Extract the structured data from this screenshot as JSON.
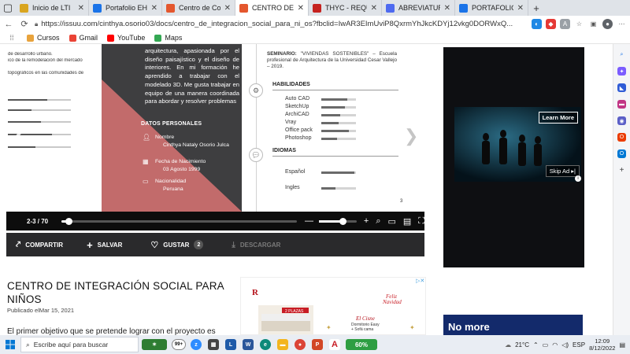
{
  "browser": {
    "tabs": [
      {
        "label": "Inicio de LTI",
        "fav": "#d9a520",
        "active": false
      },
      {
        "label": "Portafolio EHYSC",
        "fav": "#1a73e8",
        "active": false
      },
      {
        "label": "Centro de Conve",
        "fav": "#e4572e",
        "active": false
      },
      {
        "label": "CENTRO DE INTE",
        "fav": "#e4572e",
        "active": true
      },
      {
        "label": "THYC - REQUISIT",
        "fav": "#c5221f",
        "active": false
      },
      {
        "label": "ABREVIATURAS D",
        "fav": "#4e6af0",
        "active": false
      },
      {
        "label": "PORTAFOLIO - A",
        "fav": "#1a73e8",
        "active": false
      }
    ],
    "url": "https://issuu.com/cinthya.osorio03/docs/centro_de_integracion_social_para_ni_os?fbclid=IwAR3EImUviP8QxrmYhJkcKDYj12vkg0DORWxQ...",
    "bookmarks": [
      {
        "label": "Cursos",
        "color": "#e8a33d"
      },
      {
        "label": "Gmail",
        "color": "#ea4335"
      },
      {
        "label": "YouTube",
        "color": "#ff0000"
      },
      {
        "label": "Maps",
        "color": "#34a853"
      }
    ]
  },
  "doc": {
    "left_lines": [
      "de desarrollo urbano.",
      "ico de la remodelación del mercado",
      "",
      "topográficos en las comunidades de"
    ],
    "left_bars": [
      0.62,
      0.38,
      0.52,
      0.7,
      0.44
    ],
    "profile_text": "arquitectura, apasionada por el diseño paisajístico y el diseño de interiores. En mi formación he aprendido a trabajar con el modelado 3D. Me gusta trabajar en equipo de una manera coordinada para abordar y resolver problemas",
    "personal_heading": "DATOS PERSONALES",
    "personal": [
      {
        "label": "Nombre",
        "value": "Cinthya Nataly Osorio Julca"
      },
      {
        "label": "Fecha de Nacimiento",
        "value": "03 Agosto 1999"
      },
      {
        "label": "Nacionalidad",
        "value": "Peruana"
      }
    ],
    "seminar_label": "SEMINARIO:",
    "seminar_text": " \"VIVIENDAS SOSTENIBLES\" – Escuela profesional de Arquitectura de la Universidad Cesar Vallejo – 2019.",
    "skills_heading": "HABILIDADES",
    "skills": [
      {
        "name": "Auto CAD",
        "level": 0.75
      },
      {
        "name": "SketchUp",
        "level": 0.68
      },
      {
        "name": "ArchiCAD",
        "level": 0.55
      },
      {
        "name": "Vray",
        "level": 0.5
      },
      {
        "name": "Office pack",
        "level": 0.8
      },
      {
        "name": "Photoshop",
        "level": 0.45
      }
    ],
    "languages_heading": "IDIOMAS",
    "languages": [
      {
        "name": "Español",
        "level": 0.95
      },
      {
        "name": "Ingles",
        "level": 0.4
      }
    ],
    "page_number": "3"
  },
  "viewer": {
    "pager": "2-3 / 70",
    "progress": 0.03,
    "zoom": 0.62
  },
  "actions": {
    "share": "COMPARTIR",
    "save": "SALVAR",
    "like": "GUSTAR",
    "like_count": "2",
    "download": "DESCARGAR"
  },
  "article": {
    "title": "CENTRO DE INTEGRACIÓN SOCIAL PARA NIÑOS",
    "meta": "Publicado elMar 15, 2021",
    "body": "El primer objetivo que se pretende lograr con el proyecto es"
  },
  "ads": {
    "learn_more": "Learn More",
    "skip_ad": "Skip Ad",
    "blue_ad_text": "No more"
  },
  "taskbar": {
    "search_placeholder": "Escribe aquí para buscar",
    "battery": "60%",
    "weather": "21°C",
    "language": "ESP",
    "time": "12:09",
    "date": "8/12/2022",
    "badge": "99+"
  }
}
